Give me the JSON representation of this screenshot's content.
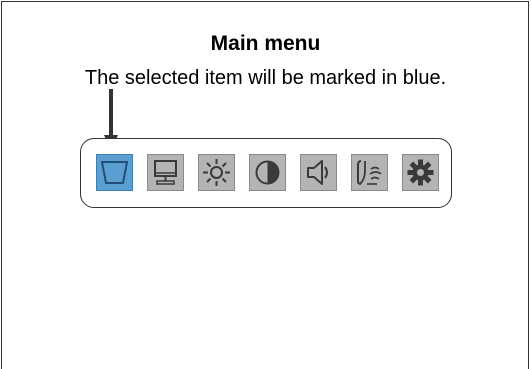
{
  "heading": {
    "title": "Main menu",
    "subtitle": "The selected item will be marked in blue."
  },
  "menu": {
    "selected_index": 0,
    "items": [
      {
        "icon": "trapezoid-icon",
        "selected": true
      },
      {
        "icon": "monitor-icon",
        "selected": false
      },
      {
        "icon": "brightness-icon",
        "selected": false
      },
      {
        "icon": "contrast-icon",
        "selected": false
      },
      {
        "icon": "speaker-icon",
        "selected": false
      },
      {
        "icon": "language-icon",
        "selected": false
      },
      {
        "icon": "gear-icon",
        "selected": false
      }
    ]
  },
  "colors": {
    "selected": "#5a9fd0",
    "unselected": "#b4b4b4",
    "icon_stroke": "#3a3a3a"
  }
}
